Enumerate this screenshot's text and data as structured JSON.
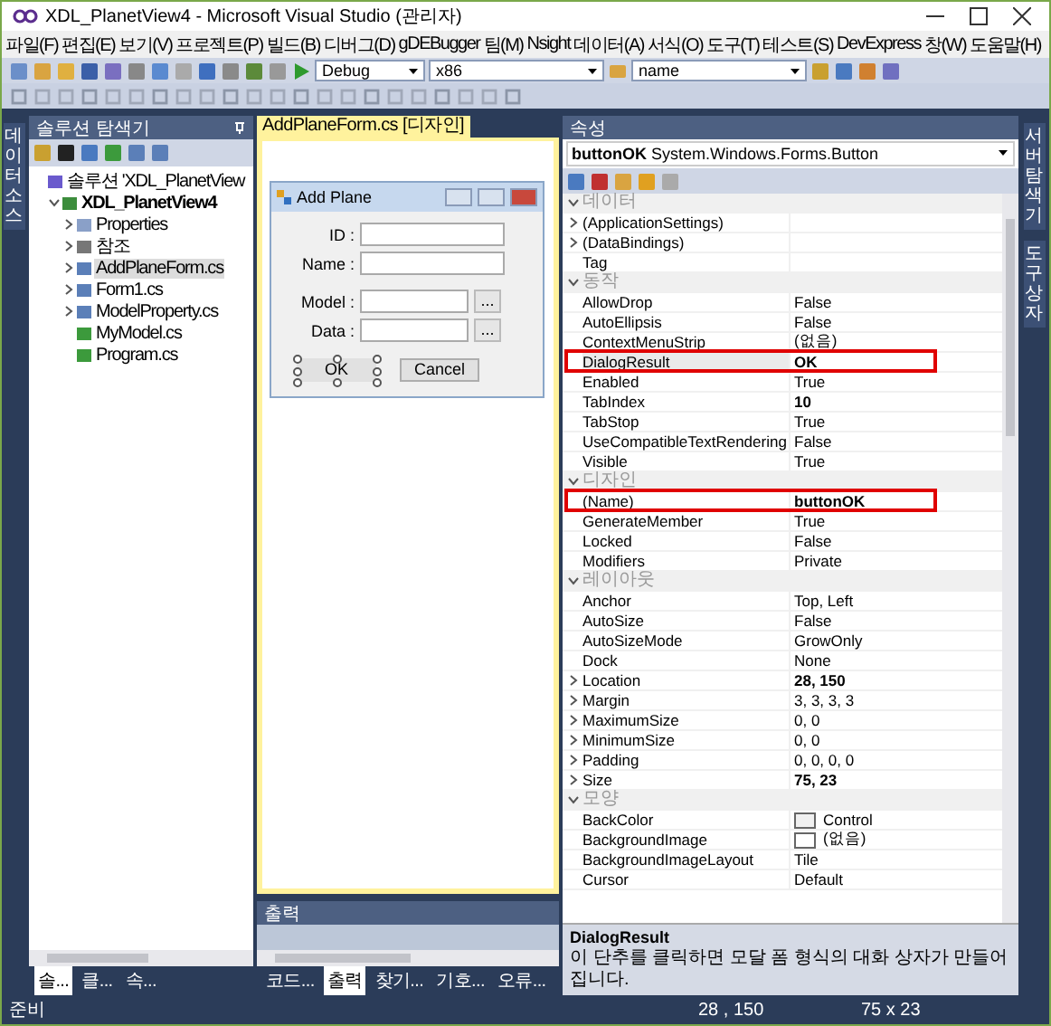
{
  "window": {
    "title": "XDL_PlanetView4 - Microsoft Visual Studio (관리자)"
  },
  "menu": [
    "파일(F)",
    "편집(E)",
    "보기(V)",
    "프로젝트(P)",
    "빌드(B)",
    "디버그(D)",
    "gDEBugger",
    "팀(M)",
    "Nsight",
    "데이터(A)",
    "서식(O)",
    "도구(T)",
    "테스트(S)",
    "DevExpress",
    "창(W)",
    "도움말(H)"
  ],
  "toolbar": {
    "configuration": "Debug",
    "platform": "x86",
    "find": "name"
  },
  "side_tabs_left": [
    "데이터 소스"
  ],
  "side_tabs_right": [
    "서버 탐색기",
    "도구 상자"
  ],
  "solution_explorer": {
    "title": "솔루션 탐색기",
    "tree": [
      {
        "label": "솔루션 'XDL_PlanetView",
        "kind": "solution",
        "selected": false,
        "children": [
          {
            "label": "XDL_PlanetView4",
            "kind": "project",
            "bold": true,
            "expanded": true,
            "selected": false,
            "children": [
              {
                "label": "Properties",
                "kind": "folder",
                "expanded": false,
                "selected": false
              },
              {
                "label": "참조",
                "kind": "references",
                "expanded": false,
                "selected": false
              },
              {
                "label": "AddPlaneForm.cs",
                "kind": "form",
                "expanded": false,
                "selected": true
              },
              {
                "label": "Form1.cs",
                "kind": "form",
                "expanded": false,
                "selected": false
              },
              {
                "label": "ModelProperty.cs",
                "kind": "form",
                "expanded": false,
                "selected": false
              },
              {
                "label": "MyModel.cs",
                "kind": "code",
                "selected": false
              },
              {
                "label": "Program.cs",
                "kind": "code",
                "selected": false
              }
            ]
          }
        ]
      }
    ]
  },
  "left_tabs": [
    {
      "label": "솔...",
      "selected": true
    },
    {
      "label": "클...",
      "selected": false
    },
    {
      "label": "속...",
      "selected": false
    }
  ],
  "designer": {
    "tab": "AddPlaneForm.cs [디자인]",
    "form": {
      "title": "Add Plane",
      "fields": [
        {
          "label": "ID :"
        },
        {
          "label": "Name :"
        },
        {
          "label": "Model :",
          "button": "..."
        },
        {
          "label": "Data :",
          "button": "..."
        }
      ],
      "buttons": [
        {
          "label": "OK",
          "selected": true
        },
        {
          "label": "Cancel",
          "selected": false
        }
      ]
    }
  },
  "output": {
    "title": "출력"
  },
  "bottom_tabs": [
    {
      "label": "코드...",
      "selected": false
    },
    {
      "label": "출력",
      "selected": true
    },
    {
      "label": "찾기...",
      "selected": false
    },
    {
      "label": "기호...",
      "selected": false
    },
    {
      "label": "오류...",
      "selected": false
    }
  ],
  "properties": {
    "title": "속성",
    "object_name": "buttonOK",
    "object_type": "System.Windows.Forms.Button",
    "categories": [
      {
        "name": "데이터",
        "expanded": true,
        "rows": [
          {
            "name": "(ApplicationSettings)",
            "expandable": true,
            "selected": false
          },
          {
            "name": "(DataBindings)",
            "expandable": true,
            "selected": false
          },
          {
            "name": "Tag",
            "selected": false
          }
        ]
      },
      {
        "name": "동작",
        "expanded": true,
        "rows": [
          {
            "name": "AllowDrop",
            "value": "False",
            "selected": false
          },
          {
            "name": "AutoEllipsis",
            "value": "False",
            "selected": false
          },
          {
            "name": "ContextMenuStrip",
            "value": "(없음)",
            "selected": false
          },
          {
            "name": "DialogResult",
            "value": "OK",
            "bold": true,
            "selected": true,
            "highlighted": true
          },
          {
            "name": "Enabled",
            "value": "True",
            "selected": false
          },
          {
            "name": "TabIndex",
            "value": "10",
            "bold": true,
            "selected": false
          },
          {
            "name": "TabStop",
            "value": "True",
            "selected": false
          },
          {
            "name": "UseCompatibleTextRendering",
            "value": "False",
            "selected": false
          },
          {
            "name": "Visible",
            "value": "True",
            "selected": false
          }
        ]
      },
      {
        "name": "디자인",
        "expanded": true,
        "rows": [
          {
            "name": "(Name)",
            "value": "buttonOK",
            "bold": true,
            "selected": false,
            "highlighted": true
          },
          {
            "name": "GenerateMember",
            "value": "True",
            "selected": false
          },
          {
            "name": "Locked",
            "value": "False",
            "selected": false
          },
          {
            "name": "Modifiers",
            "value": "Private",
            "selected": false
          }
        ]
      },
      {
        "name": "레이아웃",
        "expanded": true,
        "rows": [
          {
            "name": "Anchor",
            "value": "Top, Left",
            "selected": false
          },
          {
            "name": "AutoSize",
            "value": "False",
            "selected": false
          },
          {
            "name": "AutoSizeMode",
            "value": "GrowOnly",
            "selected": false
          },
          {
            "name": "Dock",
            "value": "None",
            "selected": false
          },
          {
            "name": "Location",
            "value": "28, 150",
            "bold": true,
            "expandable": true,
            "selected": false
          },
          {
            "name": "Margin",
            "value": "3, 3, 3, 3",
            "expandable": true,
            "selected": false
          },
          {
            "name": "MaximumSize",
            "value": "0, 0",
            "expandable": true,
            "selected": false
          },
          {
            "name": "MinimumSize",
            "value": "0, 0",
            "expandable": true,
            "selected": false
          },
          {
            "name": "Padding",
            "value": "0, 0, 0, 0",
            "expandable": true,
            "selected": false
          },
          {
            "name": "Size",
            "value": "75, 23",
            "bold": true,
            "expandable": true,
            "selected": false
          }
        ]
      },
      {
        "name": "모양",
        "expanded": true,
        "rows": [
          {
            "name": "BackColor",
            "value": "Control",
            "color": "#f0f0f0",
            "selected": false
          },
          {
            "name": "BackgroundImage",
            "value": "(없음)",
            "color": "#ffffff",
            "selected": false
          },
          {
            "name": "BackgroundImageLayout",
            "value": "Tile",
            "selected": false
          },
          {
            "name": "Cursor",
            "value": "Default",
            "selected": false
          }
        ]
      }
    ],
    "description": {
      "title": "DialogResult",
      "text": "이 단추를 클릭하면 모달 폼 형식의 대화 상자가 만들어집니다."
    }
  },
  "status_bar": {
    "text": "준비",
    "position": "28 , 150",
    "size": "75 x 23"
  }
}
